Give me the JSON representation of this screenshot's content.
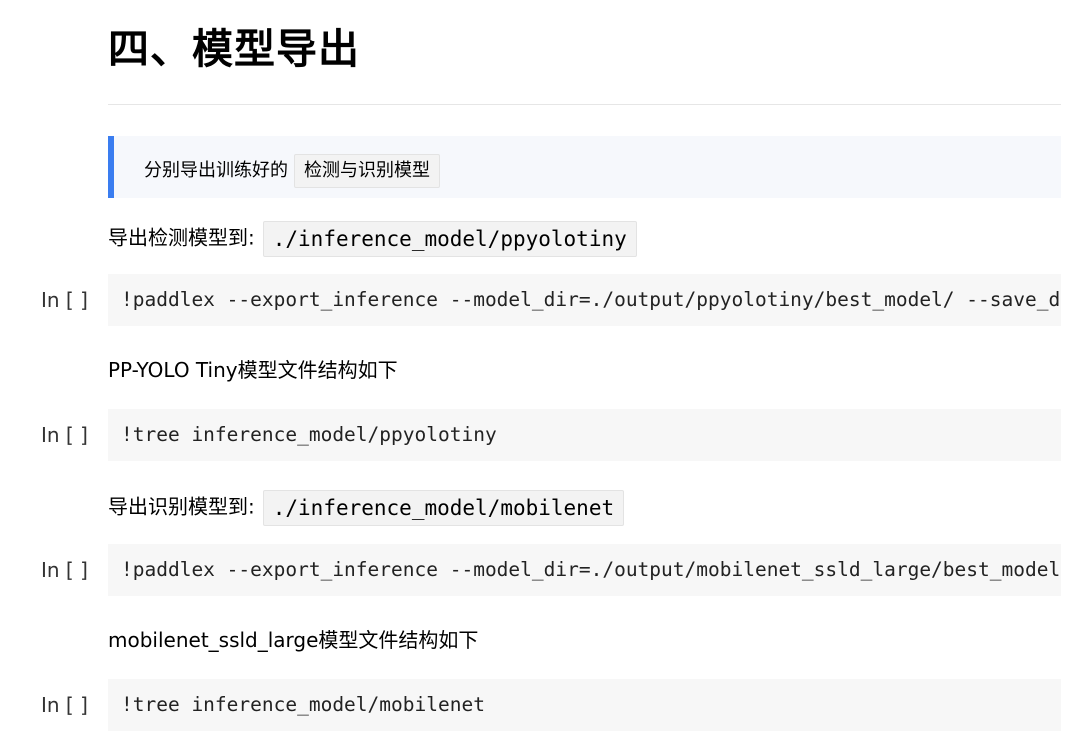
{
  "heading": "四、模型导出",
  "note": {
    "text": "分别导出训练好的",
    "code": "检测与识别模型"
  },
  "sections": [
    {
      "text": "导出检测模型到:",
      "code": "./inference_model/ppyolotiny"
    },
    {
      "text": "PP-YOLO Tiny模型文件结构如下"
    },
    {
      "text": "导出识别模型到:",
      "code": "./inference_model/mobilenet"
    },
    {
      "text": "mobilenet_ssld_large模型文件结构如下"
    }
  ],
  "cells": [
    {
      "prompt": "In [ ]",
      "code": "!paddlex --export_inference --model_dir=./output/ppyolotiny/best_model/ --save_dir=./inference_model/ppyolotiny"
    },
    {
      "prompt": "In [ ]",
      "code": "!tree inference_model/ppyolotiny"
    },
    {
      "prompt": "In [ ]",
      "code": "!paddlex --export_inference --model_dir=./output/mobilenet_ssld_large/best_model/ --save_dir=./inference_model/mobilenet"
    },
    {
      "prompt": "In [ ]",
      "code": "!tree inference_model/mobilenet"
    }
  ],
  "colors": {
    "note_border": "#3a7df0",
    "note_bg": "#f6f8fc",
    "cell_bg": "#f7f7f7"
  }
}
